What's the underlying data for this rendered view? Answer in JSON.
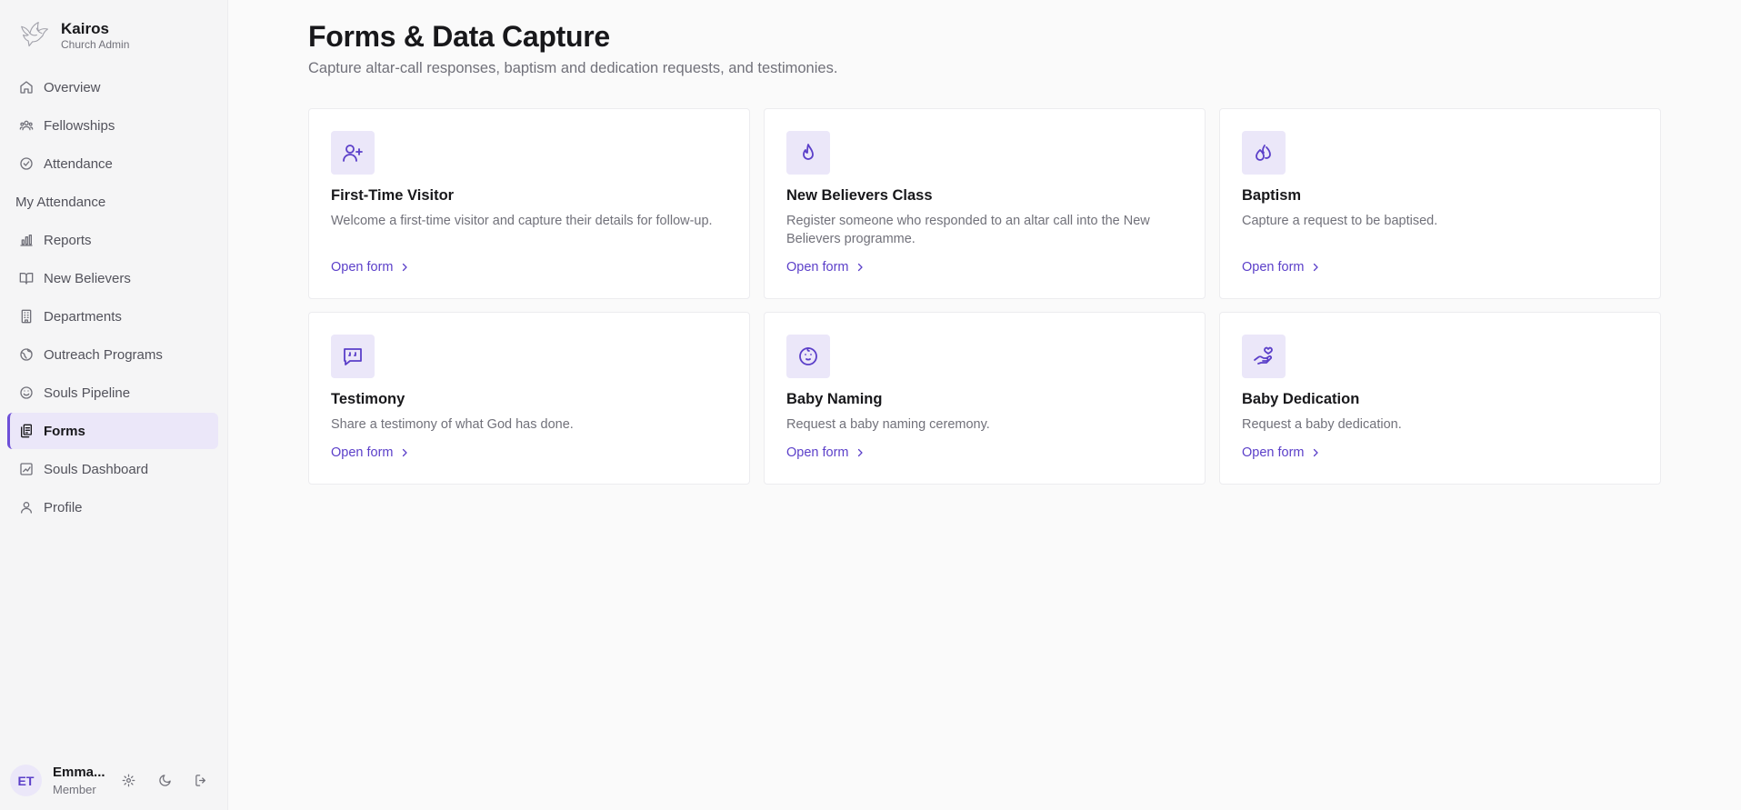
{
  "brand": {
    "name": "Kairos",
    "subtitle": "Church Admin"
  },
  "sidebar": {
    "items": [
      {
        "label": "Overview",
        "icon": "home-icon"
      },
      {
        "label": "Fellowships",
        "icon": "group-icon"
      },
      {
        "label": "Attendance",
        "icon": "check-circle-icon"
      },
      {
        "label": "My Attendance",
        "icon": ""
      },
      {
        "label": "Reports",
        "icon": "bar-chart-icon"
      },
      {
        "label": "New Believers",
        "icon": "book-open-icon"
      },
      {
        "label": "Departments",
        "icon": "building-icon"
      },
      {
        "label": "Outreach Programs",
        "icon": "globe-icon"
      },
      {
        "label": "Souls Pipeline",
        "icon": "smile-icon"
      },
      {
        "label": "Forms",
        "icon": "clipboard-icon",
        "active": true
      },
      {
        "label": "Souls Dashboard",
        "icon": "chart-icon"
      },
      {
        "label": "Profile",
        "icon": "user-icon"
      }
    ]
  },
  "user": {
    "initials": "ET",
    "name": "Emma...",
    "role": "Member"
  },
  "page": {
    "title": "Forms & Data Capture",
    "subtitle": "Capture altar-call responses, baptism and dedication requests, and testimonies."
  },
  "cards": [
    {
      "title": "First-Time Visitor",
      "description": "Welcome a first-time visitor and capture their details for follow-up.",
      "link": "Open form",
      "icon": "user-plus-icon"
    },
    {
      "title": "New Believers Class",
      "description": "Register someone who responded to an altar call into the New Believers programme.",
      "link": "Open form",
      "icon": "flame-icon"
    },
    {
      "title": "Baptism",
      "description": "Capture a request to be baptised.",
      "link": "Open form",
      "icon": "droplets-icon"
    },
    {
      "title": "Testimony",
      "description": "Share a testimony of what God has done.",
      "link": "Open form",
      "icon": "message-quote-icon"
    },
    {
      "title": "Baby Naming",
      "description": "Request a baby naming ceremony.",
      "link": "Open form",
      "icon": "baby-icon"
    },
    {
      "title": "Baby Dedication",
      "description": "Request a baby dedication.",
      "link": "Open form",
      "icon": "hand-heart-icon"
    }
  ],
  "colors": {
    "accent": "#5b3fc9",
    "accent_bg": "#ebe7f9",
    "sidebar_bg": "#f5f5f6",
    "page_bg": "#fafafa"
  }
}
